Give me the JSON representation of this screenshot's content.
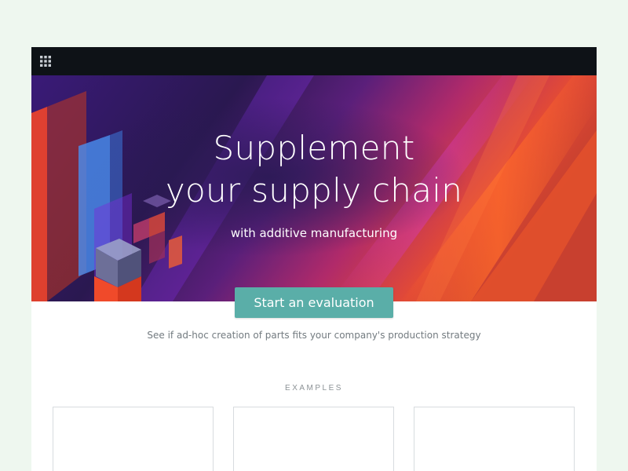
{
  "hero": {
    "title_line1": "Supplement",
    "title_line2": "your supply chain",
    "subtitle": "with additive manufacturing"
  },
  "cta": {
    "label": "Start an evaluation",
    "caption": "See if ad-hoc creation of parts fits your company's production strategy"
  },
  "examples": {
    "heading": "EXAMPLES",
    "cards": 3
  },
  "colors": {
    "page_background": "#eef7ef",
    "topbar": "#0e1217",
    "cta_button": "#5aaea8",
    "hero_orange": "#f25a2a",
    "hero_purple": "#7a2dd6",
    "hero_blue": "#4a8ef0"
  },
  "icons": {
    "app_menu": "grid-icon"
  }
}
